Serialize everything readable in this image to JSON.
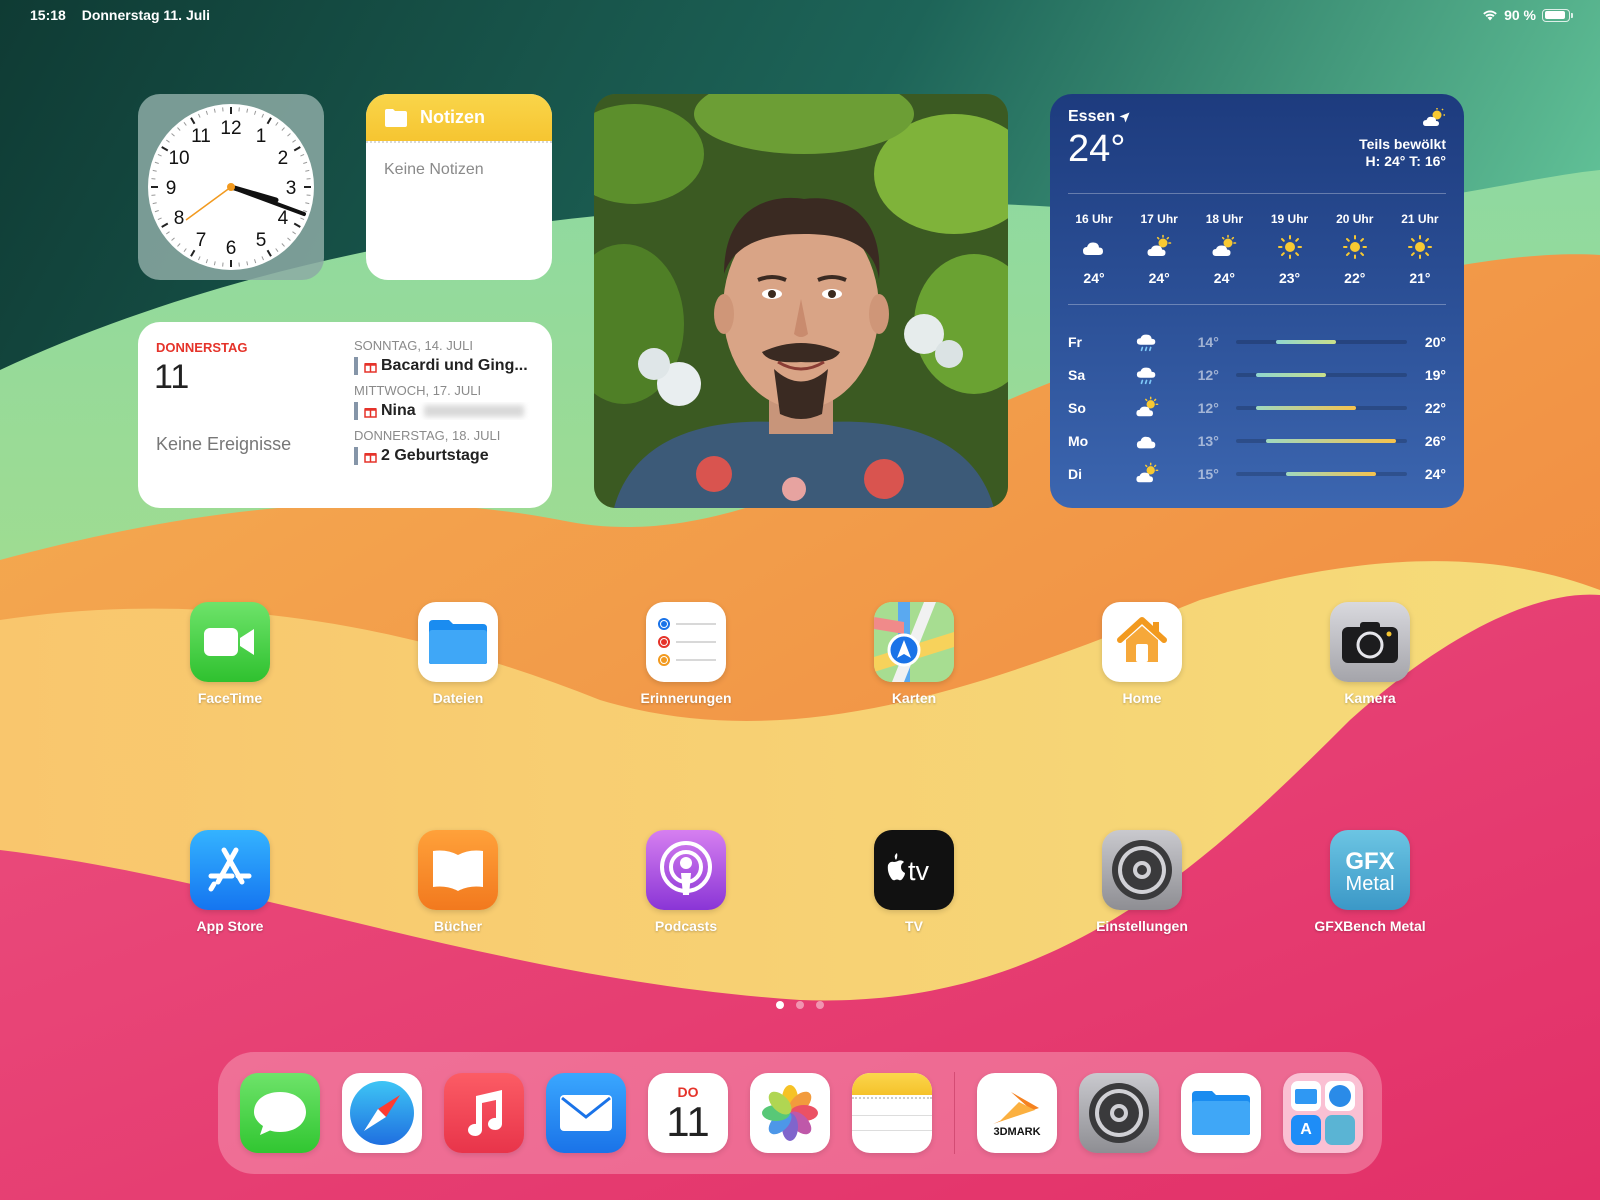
{
  "status_bar": {
    "time": "15:18",
    "date": "Donnerstag 11. Juli",
    "battery": "90 %",
    "battery_level": 0.9
  },
  "widgets": {
    "clock": {
      "numbers": [
        "12",
        "1",
        "2",
        "3",
        "4",
        "5",
        "6",
        "7",
        "8",
        "9",
        "10",
        "11"
      ]
    },
    "notes": {
      "title": "Notizen",
      "empty_text": "Keine Notizen"
    },
    "calendar": {
      "weekday": "DONNERSTAG",
      "day": "11",
      "no_events": "Keine Ereignisse",
      "groups": [
        {
          "header": "SONNTAG, 14. JULI",
          "event": "Bacardi und Ging..."
        },
        {
          "header": "MITTWOCH, 17. JULI",
          "event": "Nina"
        },
        {
          "header": "DONNERSTAG, 18. JULI",
          "event": "2 Geburtstage"
        }
      ]
    },
    "weather": {
      "location": "Essen",
      "temperature": "24°",
      "condition": "Teils bewölkt",
      "high_low": "H: 24° T: 16°",
      "hourly": [
        {
          "time": "16 Uhr",
          "icon": "cloud-icon",
          "temp": "24°"
        },
        {
          "time": "17 Uhr",
          "icon": "partly-sunny-icon",
          "temp": "24°"
        },
        {
          "time": "18 Uhr",
          "icon": "partly-sunny-icon",
          "temp": "24°"
        },
        {
          "time": "19 Uhr",
          "icon": "sun-icon",
          "temp": "23°"
        },
        {
          "time": "20 Uhr",
          "icon": "sun-icon",
          "temp": "22°"
        },
        {
          "time": "21 Uhr",
          "icon": "sun-icon",
          "temp": "21°"
        }
      ],
      "daily": [
        {
          "day": "Fr",
          "icon": "rain-icon",
          "low": "14°",
          "high": "20°"
        },
        {
          "day": "Sa",
          "icon": "rain-icon",
          "low": "12°",
          "high": "19°"
        },
        {
          "day": "So",
          "icon": "partly-sunny-icon",
          "low": "12°",
          "high": "22°"
        },
        {
          "day": "Mo",
          "icon": "cloud-icon",
          "low": "13°",
          "high": "26°"
        },
        {
          "day": "Di",
          "icon": "partly-sunny-icon",
          "low": "15°",
          "high": "24°"
        }
      ]
    }
  },
  "apps": [
    {
      "label": "FaceTime",
      "icon": "facetime-icon"
    },
    {
      "label": "Dateien",
      "icon": "files-icon"
    },
    {
      "label": "Erinnerungen",
      "icon": "reminders-icon"
    },
    {
      "label": "Karten",
      "icon": "maps-icon"
    },
    {
      "label": "Home",
      "icon": "home-icon"
    },
    {
      "label": "Kamera",
      "icon": "camera-icon"
    },
    {
      "label": "App Store",
      "icon": "app-store-icon"
    },
    {
      "label": "Bücher",
      "icon": "books-icon"
    },
    {
      "label": "Podcasts",
      "icon": "podcasts-icon"
    },
    {
      "label": "TV",
      "icon": "tv-icon"
    },
    {
      "label": "Einstellungen",
      "icon": "settings-icon"
    },
    {
      "label": "GFXBench Metal",
      "icon": "gfxbench-icon"
    }
  ],
  "page_dots": {
    "count": 3,
    "active": 0
  },
  "dock": {
    "apps": [
      "messages-icon",
      "safari-icon",
      "music-icon",
      "mail-icon",
      "calendar-icon",
      "photos-icon",
      "notes-icon"
    ],
    "recent": [
      "3dmark-icon",
      "settings-icon",
      "files-icon",
      "app-library-icon"
    ],
    "calendar_weekday": "DO",
    "calendar_day": "11",
    "threedmark_text": "3DMARK",
    "gfx_text": "GFX",
    "metal_text": "Metal"
  },
  "colors": {
    "calendar_red": "#e5332a",
    "notes_yellow": "#f6c531",
    "weather_blue": "#1d3b7e"
  }
}
